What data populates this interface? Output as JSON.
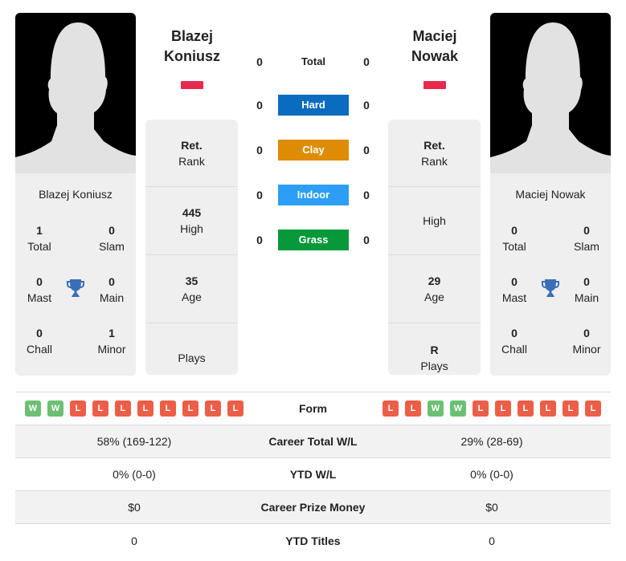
{
  "players": [
    {
      "first_name": "Blazej",
      "last_name": "Koniusz",
      "full_name": "Blazej Koniusz",
      "titles": {
        "total": {
          "value": "1",
          "label": "Total"
        },
        "slam": {
          "value": "0",
          "label": "Slam"
        },
        "mast": {
          "value": "0",
          "label": "Mast"
        },
        "main": {
          "value": "0",
          "label": "Main"
        },
        "chall": {
          "value": "0",
          "label": "Chall"
        },
        "minor": {
          "value": "1",
          "label": "Minor"
        }
      },
      "info": {
        "rank": {
          "value": "Ret.",
          "label": "Rank"
        },
        "high": {
          "value": "445",
          "label": "High"
        },
        "age": {
          "value": "35",
          "label": "Age"
        },
        "plays": {
          "value": "",
          "label": "Plays"
        }
      },
      "form": [
        "W",
        "W",
        "L",
        "L",
        "L",
        "L",
        "L",
        "L",
        "L",
        "L"
      ],
      "career_wl": "58% (169-122)",
      "ytd_wl": "0% (0-0)",
      "prize_money": "$0",
      "ytd_titles": "0"
    },
    {
      "first_name": "Maciej",
      "last_name": "Nowak",
      "full_name": "Maciej Nowak",
      "titles": {
        "total": {
          "value": "0",
          "label": "Total"
        },
        "slam": {
          "value": "0",
          "label": "Slam"
        },
        "mast": {
          "value": "0",
          "label": "Mast"
        },
        "main": {
          "value": "0",
          "label": "Main"
        },
        "chall": {
          "value": "0",
          "label": "Chall"
        },
        "minor": {
          "value": "0",
          "label": "Minor"
        }
      },
      "info": {
        "rank": {
          "value": "Ret.",
          "label": "Rank"
        },
        "high": {
          "value": "",
          "label": "High"
        },
        "age": {
          "value": "29",
          "label": "Age"
        },
        "plays": {
          "value": "R",
          "label": "Plays"
        }
      },
      "form": [
        "L",
        "L",
        "W",
        "W",
        "L",
        "L",
        "L",
        "L",
        "L",
        "L"
      ],
      "career_wl": "29% (28-69)",
      "ytd_wl": "0% (0-0)",
      "prize_money": "$0",
      "ytd_titles": "0"
    }
  ],
  "surfaces": [
    {
      "label": "Total",
      "p1": "0",
      "p2": "0",
      "color": ""
    },
    {
      "label": "Hard",
      "p1": "0",
      "p2": "0",
      "color": "#0a6bbf"
    },
    {
      "label": "Clay",
      "p1": "0",
      "p2": "0",
      "color": "#dd8c04"
    },
    {
      "label": "Indoor",
      "p1": "0",
      "p2": "0",
      "color": "#2d9ef5"
    },
    {
      "label": "Grass",
      "p1": "0",
      "p2": "0",
      "color": "#079839"
    }
  ],
  "table_labels": {
    "form": "Form",
    "career_wl": "Career Total W/L",
    "ytd_wl": "YTD W/L",
    "prize_money": "Career Prize Money",
    "ytd_titles": "YTD Titles"
  },
  "colors": {
    "flag": "#e8294e",
    "trophy": "#3a6fb8",
    "win": "#6cbf73",
    "loss": "#ec5e48"
  }
}
